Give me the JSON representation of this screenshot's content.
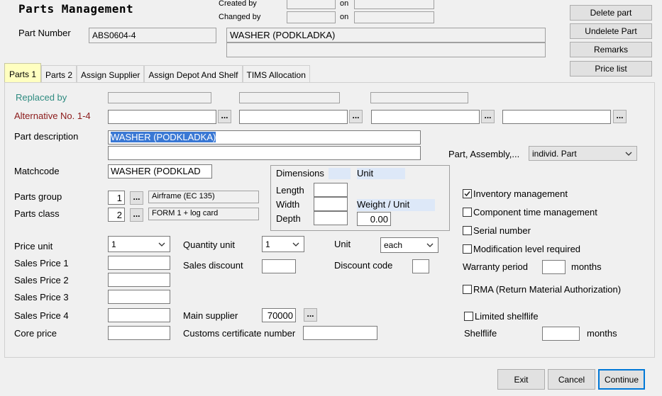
{
  "header": {
    "title": "Parts Management",
    "created_by_label": "Created by",
    "changed_by_label": "Changed by",
    "on_label": "on",
    "created_by_value": "",
    "created_on_value": "",
    "changed_by_value": "",
    "changed_on_value": "",
    "part_number_label": "Part Number",
    "part_number_value": "ABS0604-4",
    "description_line1": "WASHER (PODKLADKA)",
    "description_line2": ""
  },
  "side_buttons": {
    "delete_part": "Delete part",
    "undelete_part": "Undelete Part",
    "remarks": "Remarks",
    "price_list": "Price list"
  },
  "tabs": [
    {
      "label": "Parts 1",
      "active": true
    },
    {
      "label": "Parts 2",
      "active": false
    },
    {
      "label": "Assign Supplier",
      "active": false
    },
    {
      "label": "Assign Depot And Shelf",
      "active": false
    },
    {
      "label": "TIMS Allocation",
      "active": false
    }
  ],
  "form": {
    "replaced_by_label": "Replaced by",
    "replaced_by_values": [
      "",
      "",
      ""
    ],
    "alternative_label": "Alternative No. 1-4",
    "alternative_values": [
      "",
      "",
      "",
      ""
    ],
    "dots": "...",
    "part_description_label": "Part description",
    "part_description_line1": "WASHER (PODKLADKA)",
    "part_description_line2": "",
    "assembly_label": "Part, Assembly,...",
    "assembly_value": "individ. Part",
    "matchcode_label": "Matchcode",
    "matchcode_value": "WASHER (PODKLAD",
    "parts_group_label": "Parts group",
    "parts_group_value": "1",
    "parts_group_text": "Airframe (EC 135)",
    "parts_class_label": "Parts class",
    "parts_class_value": "2",
    "parts_class_text": "FORM 1 + log card",
    "dimensions": {
      "header": "Dimensions",
      "unit_header": "Unit",
      "length_label": "Length",
      "width_label": "Width",
      "depth_label": "Depth",
      "length_value": "",
      "width_value": "",
      "depth_value": "",
      "weight_unit_label": "Weight / Unit",
      "weight_value": "0.00"
    },
    "checkboxes": {
      "inventory_management": {
        "label": "Inventory management",
        "checked": true
      },
      "component_time": {
        "label": "Component time management",
        "checked": false
      },
      "serial_number": {
        "label": "Serial number",
        "checked": false
      },
      "modification_level": {
        "label": "Modification level required",
        "checked": false
      },
      "rma": {
        "label": "RMA (Return Material Authorization)",
        "checked": false
      },
      "limited_shelflife": {
        "label": "Limited shelflife",
        "checked": false
      }
    },
    "warranty_label": "Warranty period",
    "warranty_value": "",
    "months_label": "months",
    "shelflife_label": "Shelflife",
    "shelflife_value": "",
    "price_unit_label": "Price unit",
    "price_unit_value": "1",
    "quantity_unit_label": "Quantity unit",
    "quantity_unit_value": "1",
    "unit_label": "Unit",
    "unit_value": "each",
    "sales_price_1_label": "Sales Price 1",
    "sales_price_2_label": "Sales Price 2",
    "sales_price_3_label": "Sales Price 3",
    "sales_price_4_label": "Sales Price 4",
    "core_price_label": "Core price",
    "sales_discount_label": "Sales discount",
    "discount_code_label": "Discount code",
    "main_supplier_label": "Main supplier",
    "main_supplier_value": "70000",
    "customs_label": "Customs certificate number",
    "customs_value": ""
  },
  "footer": {
    "exit": "Exit",
    "cancel": "Cancel",
    "continue": "Continue"
  }
}
